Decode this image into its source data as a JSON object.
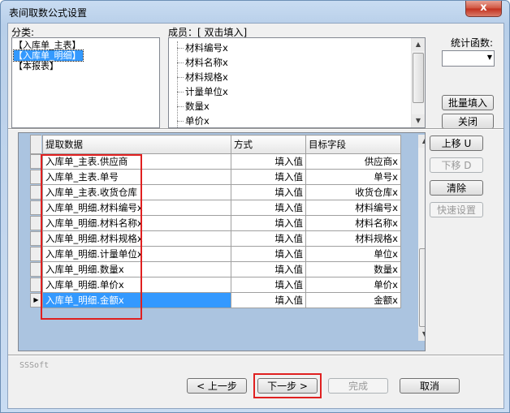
{
  "window": {
    "title": "表间取数公式设置",
    "close_label": "x"
  },
  "category": {
    "label": "分类:",
    "items": [
      {
        "label": "【入库单_主表】",
        "selected": false
      },
      {
        "label": "【入库单_明细】",
        "selected": true
      },
      {
        "label": "【本报表】",
        "selected": false
      }
    ]
  },
  "members": {
    "label": "成员：[ 双击填入]",
    "items": [
      "材料编号x",
      "材料名称x",
      "材料规格x",
      "计量单位x",
      "数量x",
      "单价x"
    ]
  },
  "stat_function": {
    "label": "统计函数:",
    "value": ""
  },
  "buttons": {
    "batch_fill": "批量填入",
    "close": "关闭",
    "move_up": "上移 U",
    "move_down": "下移 D",
    "clear": "清除",
    "quick_settings": "快速设置",
    "prev": "< 上一步",
    "next": "下一步 >",
    "finish": "完成",
    "cancel": "取消"
  },
  "grid": {
    "columns": [
      "提取数据",
      "方式",
      "目标字段"
    ],
    "rows": [
      {
        "data": "入库单_主表.供应商",
        "mode": "填入值",
        "target": "供应商x"
      },
      {
        "data": "入库单_主表.单号",
        "mode": "填入值",
        "target": "单号x"
      },
      {
        "data": "入库单_主表.收货仓库",
        "mode": "填入值",
        "target": "收货仓库x"
      },
      {
        "data": "入库单_明细.材料编号x",
        "mode": "填入值",
        "target": "材料编号x"
      },
      {
        "data": "入库单_明细.材料名称x",
        "mode": "填入值",
        "target": "材料名称x"
      },
      {
        "data": "入库单_明细.材料规格x",
        "mode": "填入值",
        "target": "材料规格x"
      },
      {
        "data": "入库单_明细.计量单位x",
        "mode": "填入值",
        "target": "单位x"
      },
      {
        "data": "入库单_明细.数量x",
        "mode": "填入值",
        "target": "数量x"
      },
      {
        "data": "入库单_明细.单价x",
        "mode": "填入值",
        "target": "单价x"
      },
      {
        "data": "入库单_明细.金额x",
        "mode": "填入值",
        "target": "金额x"
      }
    ],
    "current_row_marker": "▶"
  },
  "footer": {
    "brand": "SSSoft"
  },
  "colors": {
    "highlight": "#e02020",
    "selection": "#3399ff",
    "title_gradient": "#c9dcf2"
  }
}
